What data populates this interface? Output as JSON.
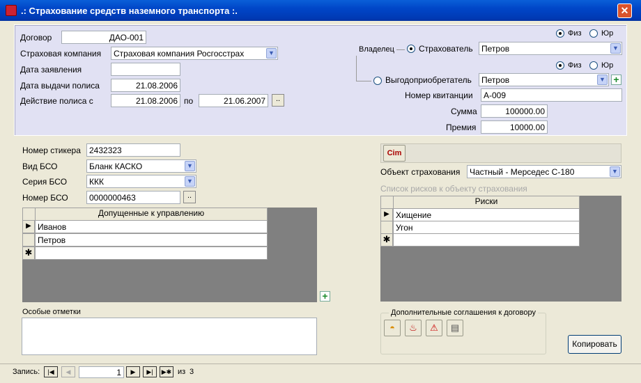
{
  "window": {
    "title": ".: Страхование средств наземного транспорта :.",
    "close_label": "✕"
  },
  "top": {
    "contract_label": "Договор",
    "contract_value": "ДАО-001",
    "company_label": "Страховая компания",
    "company_value": "Страховая компания Росгосстрах",
    "application_date_label": "Дата заявления",
    "application_date_value": "",
    "issue_date_label": "Дата выдачи полиса",
    "issue_date_value": "21.08.2006",
    "valid_from_label": "Действие полиса с",
    "valid_from_value": "21.08.2006",
    "valid_to_label": "по",
    "valid_to_value": "21.06.2007",
    "dots": "..",
    "owner_label": "Владелец",
    "insurer_label": "Страхователь",
    "insurer_value": "Петров",
    "beneficiary_label": "Выгодоприобретатель",
    "beneficiary_value": "Петров",
    "phys_label": "Физ",
    "jur_label": "Юр",
    "receipt_label": "Номер квитанции",
    "receipt_value": "А-009",
    "sum_label": "Сумма",
    "sum_value": "100000.00",
    "premium_label": "Премия",
    "premium_value": "10000.00"
  },
  "bottom_left": {
    "sticker_label": "Номер стикера",
    "sticker_value": "2432323",
    "bso_type_label": "Вид БСО",
    "bso_type_value": "Бланк КАСКО",
    "bso_series_label": "Серия БСО",
    "bso_series_value": "ККК",
    "bso_number_label": "Номер БСО",
    "bso_number_value": "0000000463",
    "drivers_header": "Допущенные к управлению",
    "drivers": [
      "Иванов",
      "Петров",
      ""
    ],
    "notes_label": "Особые отметки",
    "notes_value": ""
  },
  "bottom_right": {
    "object_label": "Объект страхования",
    "object_value": "Частный - Мерседес С-180",
    "risks_list_label": "Список рисков к объекту страхования",
    "risks_header": "Риски",
    "risks": [
      "Хищение",
      "Угон",
      ""
    ],
    "agreements_label": "Дополнительные соглашения к договору",
    "copy_button": "Копировать"
  },
  "record_nav": {
    "record_label": "Запись:",
    "current": "1",
    "of_label": "из",
    "total": "3"
  },
  "colors": {
    "panel": "#e1e1f3",
    "title_bar": "#0046c8",
    "grid_empty": "#808080"
  },
  "icons": [
    "window-icon",
    "close-icon",
    "chevron-down-icon",
    "record-selector-icon",
    "new-record-icon",
    "add-icon",
    "cim-icon",
    "helmet-icon",
    "fire-icon",
    "warning-icon",
    "document-icon",
    "first-record-icon",
    "prev-record-icon",
    "next-record-icon",
    "last-record-icon",
    "new-record-nav-icon"
  ]
}
